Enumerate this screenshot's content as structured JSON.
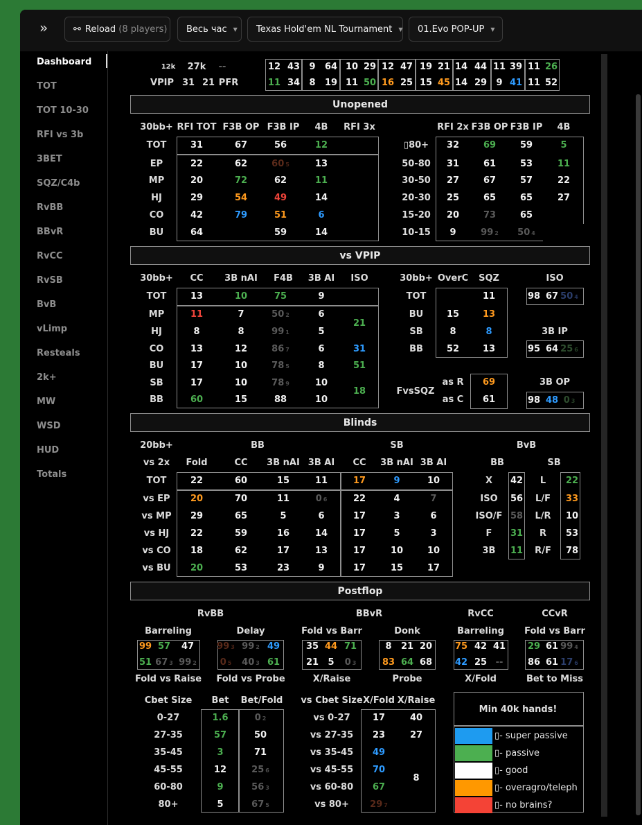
{
  "toolbar": {
    "expand_icon": "»",
    "reload_label": "Reload",
    "reload_count": "(8 players)",
    "period": "Весь час",
    "game": "Texas Hold'em NL Tournament",
    "profile": "01.Evo POP-UP"
  },
  "sidebar": [
    "Dashboard",
    "TOT",
    "TOT 10-30",
    "RFI vs 3b",
    "3BET",
    "SQZ/C4b",
    "RvBB",
    "BBvR",
    "RvCC",
    "RvSB",
    "BvB",
    "vLimp",
    "Resteals",
    "2k+",
    "MW",
    "WSD",
    "HUD",
    "Totals"
  ],
  "top": {
    "l1": "12k",
    "l2": "27k",
    "l3": "--",
    "vpip": "VPIP",
    "v1": "31",
    "v2": "21",
    "pfr": "PFR"
  },
  "sections": {
    "unopened": "Unopened",
    "vsvpip": "vs VPIP",
    "blinds": "Blinds",
    "postflop": "Postflop"
  },
  "unopened": {
    "stack": "30bb+",
    "hdr": [
      "RFI TOT",
      "F3B OP",
      "F3B IP",
      "4B",
      "RFI 3x"
    ],
    "rows": [
      "TOT",
      "EP",
      "MP",
      "HJ",
      "CO",
      "BU"
    ],
    "hdr2": [
      "RFI 2x",
      "F3B OP",
      "F3B IP",
      "4B"
    ],
    "rows2": [
      "80+",
      "50-80",
      "30-50",
      "20-30",
      "15-20",
      "10-15"
    ],
    "sq_icon": "▯"
  },
  "vsvpip": {
    "stack": "30bb+",
    "hdr": [
      "CC",
      "3B nAI",
      "F4B",
      "3B AI",
      "ISO"
    ],
    "rows": [
      "TOT",
      "MP",
      "HJ",
      "CO",
      "BU",
      "SB",
      "BB"
    ],
    "stack2": "30bb+",
    "hdr2": [
      "OverC",
      "SQZ"
    ],
    "rows2": [
      "TOT",
      "BU",
      "SB",
      "BB"
    ],
    "iso": "ISO",
    "ip3b": "3B IP",
    "op3b": "3B OP",
    "fvssqz": "FvsSQZ",
    "asr": "as R",
    "asc": "as C"
  },
  "blinds": {
    "stack": "20bb+",
    "vs": "vs 2x",
    "bb": "BB",
    "sb": "SB",
    "bvb": "BvB",
    "hdr": [
      "Fold",
      "CC",
      "3B nAI",
      "3B AI",
      "CC",
      "3B nAI",
      "3B AI"
    ],
    "rows": [
      "TOT",
      "vs EP",
      "vs MP",
      "vs HJ",
      "vs CO",
      "vs BU"
    ],
    "bbcol": "BB",
    "sbcol": "SB",
    "bbl": [
      "X",
      "ISO",
      "ISO/F",
      "F",
      "3B"
    ],
    "sbl": [
      "L",
      "L/F",
      "L/R",
      "R",
      "R/F"
    ]
  },
  "postflop": {
    "groups": [
      "RvBB",
      "BBvR",
      "RvCC",
      "CCvR"
    ],
    "sub": [
      "Barreling",
      "Delay",
      "Fold vs Barr",
      "Donk",
      "Barreling",
      "Fold vs Barr"
    ],
    "sub2": [
      "Fold vs Raise",
      "Fold vs Probe",
      "X/Raise",
      "Probe",
      "X/Fold",
      "Bet to Miss"
    ],
    "cbet": "Cbet Size",
    "bet": "Bet",
    "betfold": "Bet/Fold",
    "sizes": [
      "0-27",
      "27-35",
      "35-45",
      "45-55",
      "60-80",
      "80+"
    ],
    "vscbet": "vs Cbet Size",
    "xfold": "X/Fold",
    "xraise": "X/Raise",
    "vsizes": [
      "vs 0-27",
      "vs 27-35",
      "vs 35-45",
      "vs 45-55",
      "vs 60-80",
      "vs 80+"
    ],
    "min": "Min 40k hands!"
  },
  "legend": [
    {
      "color": "#1e9bf0",
      "icon": "▯",
      "text": "- super passive"
    },
    {
      "color": "#4caf50",
      "icon": "▯",
      "text": "- passive"
    },
    {
      "color": "#ffffff",
      "icon": "▯",
      "text": "- good"
    },
    {
      "color": "#ff9800",
      "icon": "▯",
      "text": "- overagro/teleph"
    },
    {
      "color": "#f44336",
      "icon": "▯",
      "text": "- no brains?"
    }
  ],
  "nums": [
    [
      "12",
      "43",
      "9",
      "64",
      "10",
      "29",
      "12",
      "47",
      "19",
      "21",
      "14",
      "44",
      "11",
      "39",
      "11",
      "26"
    ],
    [
      "11",
      "34",
      "8",
      "19",
      "11",
      "50",
      "16",
      "25",
      "15",
      "45",
      "14",
      "29",
      "9",
      "41",
      "11",
      "52"
    ]
  ]
}
